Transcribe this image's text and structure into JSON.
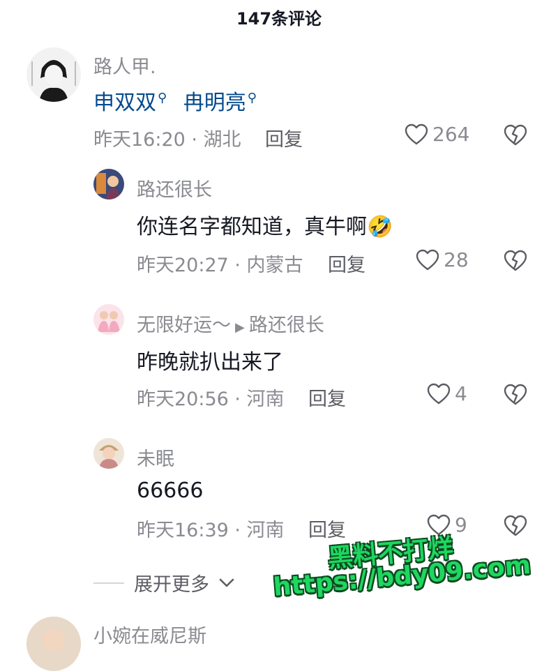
{
  "header": {
    "title": "147条评论"
  },
  "comments": [
    {
      "username": "路人甲.",
      "mentions": [
        "申双双",
        "冉明亮"
      ],
      "meta": "昨天16:20 · 湖北",
      "reply_label": "回复",
      "likes": "264"
    },
    {
      "username": "路还很长",
      "text": "你连名字都知道，真牛啊",
      "emoji": "🤣",
      "meta": "昨天20:27 · 内蒙古",
      "reply_label": "回复",
      "likes": "28"
    },
    {
      "username": "无限好运～",
      "reply_to": "路还很长",
      "text": "昨晚就扒出来了",
      "meta": "昨天20:56 · 河南",
      "reply_label": "回复",
      "likes": "4"
    },
    {
      "username": "未眠",
      "text": "66666",
      "meta": "昨天16:39 · 河南",
      "reply_label": "回复",
      "likes": "9"
    },
    {
      "username": "小婉在威尼斯"
    }
  ],
  "expand_label": "展开更多",
  "watermark": {
    "line1": "黑料不打烊",
    "line2": "https://bdy09.com"
  },
  "colors": {
    "mention": "#04498d",
    "meta": "#8a8b91",
    "text": "#161823",
    "watermark": "#1ed760"
  }
}
